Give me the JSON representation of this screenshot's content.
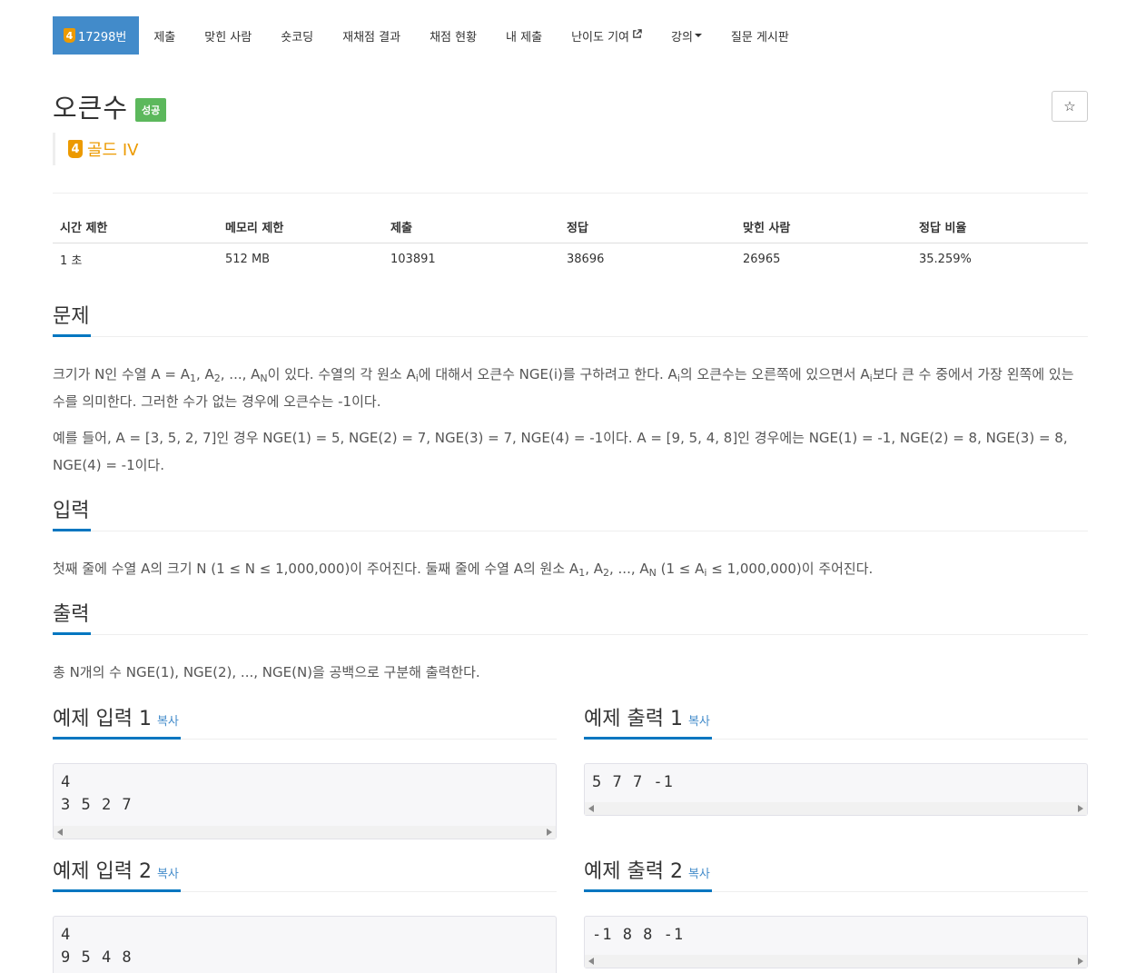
{
  "nav": {
    "problem_tab": {
      "tier_badge": "4",
      "label": "17298번"
    },
    "items": [
      "제출",
      "맞힌 사람",
      "숏코딩",
      "재채점 결과",
      "채점 현황",
      "내 제출",
      "난이도 기여",
      "강의",
      "질문 게시판"
    ]
  },
  "problem": {
    "title": "오큰수",
    "result_badge": "성공",
    "tier_badge": "4",
    "tier_label": "골드 IV",
    "star_icon": "star-icon"
  },
  "info_table": {
    "headers": [
      "시간 제한",
      "메모리 제한",
      "제출",
      "정답",
      "맞힌 사람",
      "정답 비율"
    ],
    "values": [
      "1 초",
      "512 MB",
      "103891",
      "38696",
      "26965",
      "35.259%"
    ]
  },
  "sections": {
    "description": {
      "title": "문제",
      "p1": {
        "t1": "크기가 N인 수열 A = A",
        "s1": "1",
        "t2": ", A",
        "s2": "2",
        "t3": ", ..., A",
        "s3": "N",
        "t4": "이 있다. 수열의 각 원소 A",
        "s4": "i",
        "t5": "에 대해서 오큰수 NGE(i)를 구하려고 한다. A",
        "s5": "i",
        "t6": "의 오큰수는 오른쪽에 있으면서 A",
        "s6": "i",
        "t7": "보다 큰 수 중에서 가장 왼쪽에 있는 수를 의미한다. 그러한 수가 없는 경우에 오큰수는 -1이다."
      },
      "p2": "예를 들어, A = [3, 5, 2, 7]인 경우 NGE(1) = 5, NGE(2) = 7, NGE(3) = 7, NGE(4) = -1이다. A = [9, 5, 4, 8]인 경우에는 NGE(1) = -1, NGE(2) = 8, NGE(3) = 8, NGE(4) = -1이다."
    },
    "input": {
      "title": "입력",
      "p": {
        "t1": "첫째 줄에 수열 A의 크기 N (1 ≤ N ≤ 1,000,000)이 주어진다. 둘째 줄에 수열 A의 원소 A",
        "s1": "1",
        "t2": ", A",
        "s2": "2",
        "t3": ", ..., A",
        "s3": "N",
        "t4": " (1 ≤ A",
        "s4": "i",
        "t5": " ≤ 1,000,000)이 주어진다."
      }
    },
    "output": {
      "title": "출력",
      "p": "총 N개의 수 NGE(1), NGE(2), ..., NGE(N)을 공백으로 구분해 출력한다."
    }
  },
  "samples": {
    "copy_label": "복사",
    "input1": {
      "title": "예제 입력 1",
      "content": "4\n3 5 2 7"
    },
    "output1": {
      "title": "예제 출력 1",
      "content": "5 7 7 -1"
    },
    "input2": {
      "title": "예제 입력 2",
      "content": "4\n9 5 4 8"
    },
    "output2": {
      "title": "예제 출력 2",
      "content": "-1 8 8 -1"
    }
  },
  "colors": {
    "active_tab": "#428bca",
    "tier_gold": "#ec9a00",
    "success": "#5cb85c",
    "section_underline": "#0076c0",
    "link": "#428bca"
  }
}
